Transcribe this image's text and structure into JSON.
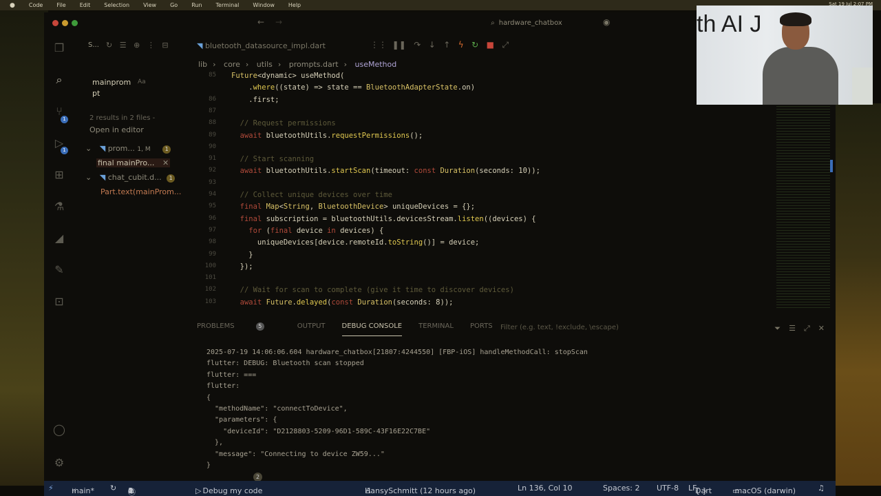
{
  "menubar": {
    "items": [
      "Code",
      "File",
      "Edit",
      "Selection",
      "View",
      "Go",
      "Run",
      "Terminal",
      "Window",
      "Help"
    ],
    "clock": "Sat 19 Jul 2:07 PM"
  },
  "window": {
    "title": "hardware_chatbox"
  },
  "activity": {
    "explorer_badge": "",
    "scm_badge": "1",
    "debug_badge": "1"
  },
  "sidebar": {
    "header": "S...",
    "query_line1": "mainprom",
    "query_line2": "pt",
    "query_toggle": "Aa",
    "results_summary": "2 results in 2 files -",
    "open_in_editor": "Open in editor",
    "results": [
      {
        "file": "prom...",
        "meta": "1, M",
        "count": "1",
        "match": "final mainPro..."
      },
      {
        "file": "chat_cubit.d...",
        "meta": "",
        "count": "1",
        "match": "Part.text(mainProm..."
      }
    ]
  },
  "editor": {
    "tab": "bluetooth_datasource_impl.dart",
    "breadcrumb": [
      "lib",
      "core",
      "utils",
      "prompts.dart",
      "useMethod"
    ],
    "lines": [
      {
        "n": "85",
        "text": "Future<dynamic> useMethod("
      },
      {
        "n": "",
        "text": "    .where((state) => state == BluetoothAdapterState.on)"
      },
      {
        "n": "86",
        "text": "    .first;"
      },
      {
        "n": "87",
        "text": ""
      },
      {
        "n": "88",
        "text": "  // Request permissions"
      },
      {
        "n": "89",
        "text": "  await bluetoothUtils.requestPermissions();"
      },
      {
        "n": "90",
        "text": ""
      },
      {
        "n": "91",
        "text": "  // Start scanning"
      },
      {
        "n": "92",
        "text": "  await bluetoothUtils.startScan(timeout: const Duration(seconds: 10));"
      },
      {
        "n": "93",
        "text": ""
      },
      {
        "n": "94",
        "text": "  // Collect unique devices over time"
      },
      {
        "n": "95",
        "text": "  final Map<String, BluetoothDevice> uniqueDevices = {};"
      },
      {
        "n": "96",
        "text": "  final subscription = bluetoothUtils.devicesStream.listen((devices) {"
      },
      {
        "n": "97",
        "text": "    for (final device in devices) {"
      },
      {
        "n": "98",
        "text": "      uniqueDevices[device.remoteId.toString()] = device;"
      },
      {
        "n": "99",
        "text": "    }"
      },
      {
        "n": "100",
        "text": "  });"
      },
      {
        "n": "101",
        "text": ""
      },
      {
        "n": "102",
        "text": "  // Wait for scan to complete (give it time to discover devices)"
      },
      {
        "n": "103",
        "text": "  await Future.delayed(const Duration(seconds: 8));"
      }
    ]
  },
  "panel": {
    "tabs": [
      "PROBLEMS",
      "OUTPUT",
      "DEBUG CONSOLE",
      "TERMINAL",
      "PORTS"
    ],
    "problems_count": "5",
    "filter_placeholder": "Filter (e.g. text, !exclude, \\escape)",
    "console": [
      "2025-07-19 14:06:06.604 hardware_chatbox[21807:4244550] [FBP-iOS] handleMethodCall: stopScan",
      "flutter: DEBUG: Bluetooth scan stopped",
      "flutter: ===",
      "flutter:",
      "{",
      "  \"methodName\": \"connectToDevice\",",
      "  \"parameters\": {",
      "    \"deviceId\": \"D2128803-5209-96D1-589C-43F16E22C7BE\"",
      "  },",
      "  \"message\": \"Connecting to device ZW59...\"",
      "}"
    ],
    "repeat_count": "2",
    "prompt": ">"
  },
  "statusbar": {
    "branch": "main*",
    "errors": "0",
    "warnings": "1",
    "infos": "4",
    "debug": "Debug my code",
    "blame": "HansySchmitt (12 hours ago)",
    "position": "Ln 136, Col 10",
    "spaces": "Spaces: 2",
    "encoding": "UTF-8",
    "eol": "LF",
    "language": "Dart",
    "platform": "macOS (darwin)"
  },
  "webcam": {
    "sign_text": "th AI J"
  },
  "colors": {
    "statusbar_bg": "#162238",
    "keyword": "#b14a3a",
    "function": "#e0c850",
    "comment": "#5e5a3a"
  }
}
